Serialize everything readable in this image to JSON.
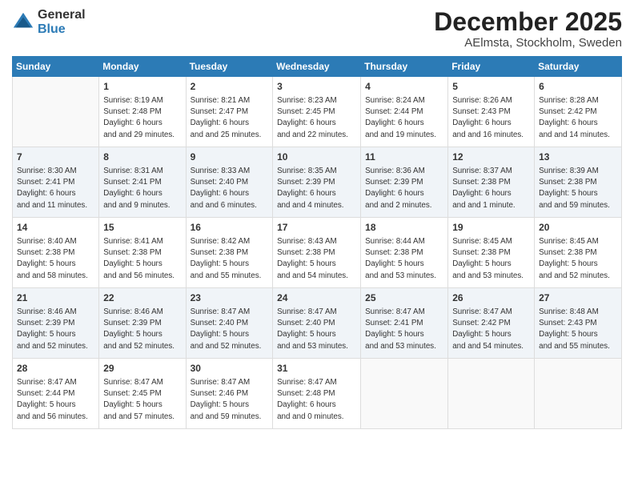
{
  "logo": {
    "general": "General",
    "blue": "Blue"
  },
  "header": {
    "month": "December 2025",
    "location": "AElmsta, Stockholm, Sweden"
  },
  "weekdays": [
    "Sunday",
    "Monday",
    "Tuesday",
    "Wednesday",
    "Thursday",
    "Friday",
    "Saturday"
  ],
  "weeks": [
    [
      {
        "day": "",
        "sunrise": "",
        "sunset": "",
        "daylight": ""
      },
      {
        "day": "1",
        "sunrise": "Sunrise: 8:19 AM",
        "sunset": "Sunset: 2:48 PM",
        "daylight": "Daylight: 6 hours and 29 minutes."
      },
      {
        "day": "2",
        "sunrise": "Sunrise: 8:21 AM",
        "sunset": "Sunset: 2:47 PM",
        "daylight": "Daylight: 6 hours and 25 minutes."
      },
      {
        "day": "3",
        "sunrise": "Sunrise: 8:23 AM",
        "sunset": "Sunset: 2:45 PM",
        "daylight": "Daylight: 6 hours and 22 minutes."
      },
      {
        "day": "4",
        "sunrise": "Sunrise: 8:24 AM",
        "sunset": "Sunset: 2:44 PM",
        "daylight": "Daylight: 6 hours and 19 minutes."
      },
      {
        "day": "5",
        "sunrise": "Sunrise: 8:26 AM",
        "sunset": "Sunset: 2:43 PM",
        "daylight": "Daylight: 6 hours and 16 minutes."
      },
      {
        "day": "6",
        "sunrise": "Sunrise: 8:28 AM",
        "sunset": "Sunset: 2:42 PM",
        "daylight": "Daylight: 6 hours and 14 minutes."
      }
    ],
    [
      {
        "day": "7",
        "sunrise": "Sunrise: 8:30 AM",
        "sunset": "Sunset: 2:41 PM",
        "daylight": "Daylight: 6 hours and 11 minutes."
      },
      {
        "day": "8",
        "sunrise": "Sunrise: 8:31 AM",
        "sunset": "Sunset: 2:41 PM",
        "daylight": "Daylight: 6 hours and 9 minutes."
      },
      {
        "day": "9",
        "sunrise": "Sunrise: 8:33 AM",
        "sunset": "Sunset: 2:40 PM",
        "daylight": "Daylight: 6 hours and 6 minutes."
      },
      {
        "day": "10",
        "sunrise": "Sunrise: 8:35 AM",
        "sunset": "Sunset: 2:39 PM",
        "daylight": "Daylight: 6 hours and 4 minutes."
      },
      {
        "day": "11",
        "sunrise": "Sunrise: 8:36 AM",
        "sunset": "Sunset: 2:39 PM",
        "daylight": "Daylight: 6 hours and 2 minutes."
      },
      {
        "day": "12",
        "sunrise": "Sunrise: 8:37 AM",
        "sunset": "Sunset: 2:38 PM",
        "daylight": "Daylight: 6 hours and 1 minute."
      },
      {
        "day": "13",
        "sunrise": "Sunrise: 8:39 AM",
        "sunset": "Sunset: 2:38 PM",
        "daylight": "Daylight: 5 hours and 59 minutes."
      }
    ],
    [
      {
        "day": "14",
        "sunrise": "Sunrise: 8:40 AM",
        "sunset": "Sunset: 2:38 PM",
        "daylight": "Daylight: 5 hours and 58 minutes."
      },
      {
        "day": "15",
        "sunrise": "Sunrise: 8:41 AM",
        "sunset": "Sunset: 2:38 PM",
        "daylight": "Daylight: 5 hours and 56 minutes."
      },
      {
        "day": "16",
        "sunrise": "Sunrise: 8:42 AM",
        "sunset": "Sunset: 2:38 PM",
        "daylight": "Daylight: 5 hours and 55 minutes."
      },
      {
        "day": "17",
        "sunrise": "Sunrise: 8:43 AM",
        "sunset": "Sunset: 2:38 PM",
        "daylight": "Daylight: 5 hours and 54 minutes."
      },
      {
        "day": "18",
        "sunrise": "Sunrise: 8:44 AM",
        "sunset": "Sunset: 2:38 PM",
        "daylight": "Daylight: 5 hours and 53 minutes."
      },
      {
        "day": "19",
        "sunrise": "Sunrise: 8:45 AM",
        "sunset": "Sunset: 2:38 PM",
        "daylight": "Daylight: 5 hours and 53 minutes."
      },
      {
        "day": "20",
        "sunrise": "Sunrise: 8:45 AM",
        "sunset": "Sunset: 2:38 PM",
        "daylight": "Daylight: 5 hours and 52 minutes."
      }
    ],
    [
      {
        "day": "21",
        "sunrise": "Sunrise: 8:46 AM",
        "sunset": "Sunset: 2:39 PM",
        "daylight": "Daylight: 5 hours and 52 minutes."
      },
      {
        "day": "22",
        "sunrise": "Sunrise: 8:46 AM",
        "sunset": "Sunset: 2:39 PM",
        "daylight": "Daylight: 5 hours and 52 minutes."
      },
      {
        "day": "23",
        "sunrise": "Sunrise: 8:47 AM",
        "sunset": "Sunset: 2:40 PM",
        "daylight": "Daylight: 5 hours and 52 minutes."
      },
      {
        "day": "24",
        "sunrise": "Sunrise: 8:47 AM",
        "sunset": "Sunset: 2:40 PM",
        "daylight": "Daylight: 5 hours and 53 minutes."
      },
      {
        "day": "25",
        "sunrise": "Sunrise: 8:47 AM",
        "sunset": "Sunset: 2:41 PM",
        "daylight": "Daylight: 5 hours and 53 minutes."
      },
      {
        "day": "26",
        "sunrise": "Sunrise: 8:47 AM",
        "sunset": "Sunset: 2:42 PM",
        "daylight": "Daylight: 5 hours and 54 minutes."
      },
      {
        "day": "27",
        "sunrise": "Sunrise: 8:48 AM",
        "sunset": "Sunset: 2:43 PM",
        "daylight": "Daylight: 5 hours and 55 minutes."
      }
    ],
    [
      {
        "day": "28",
        "sunrise": "Sunrise: 8:47 AM",
        "sunset": "Sunset: 2:44 PM",
        "daylight": "Daylight: 5 hours and 56 minutes."
      },
      {
        "day": "29",
        "sunrise": "Sunrise: 8:47 AM",
        "sunset": "Sunset: 2:45 PM",
        "daylight": "Daylight: 5 hours and 57 minutes."
      },
      {
        "day": "30",
        "sunrise": "Sunrise: 8:47 AM",
        "sunset": "Sunset: 2:46 PM",
        "daylight": "Daylight: 5 hours and 59 minutes."
      },
      {
        "day": "31",
        "sunrise": "Sunrise: 8:47 AM",
        "sunset": "Sunset: 2:48 PM",
        "daylight": "Daylight: 6 hours and 0 minutes."
      },
      {
        "day": "",
        "sunrise": "",
        "sunset": "",
        "daylight": ""
      },
      {
        "day": "",
        "sunrise": "",
        "sunset": "",
        "daylight": ""
      },
      {
        "day": "",
        "sunrise": "",
        "sunset": "",
        "daylight": ""
      }
    ]
  ]
}
